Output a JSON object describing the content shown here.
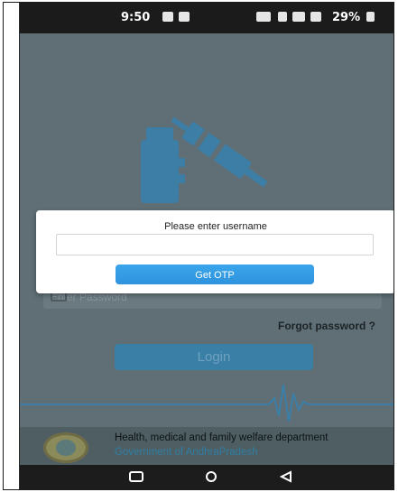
{
  "status_bar": {
    "time": "9:50",
    "battery": "29%"
  },
  "dialog": {
    "title": "Please enter username",
    "username_value": "",
    "otp_button": "Get OTP"
  },
  "form": {
    "password_placeholder": "Enter Password",
    "forgot_password": "Forgot password ?",
    "login_button": "Login"
  },
  "footer": {
    "line1": "Health, medical and family welfare department",
    "line2": "Government of AndhraPradesh"
  },
  "nav": {
    "icons": [
      "square-icon",
      "circle-icon",
      "triangle-back-icon"
    ]
  }
}
